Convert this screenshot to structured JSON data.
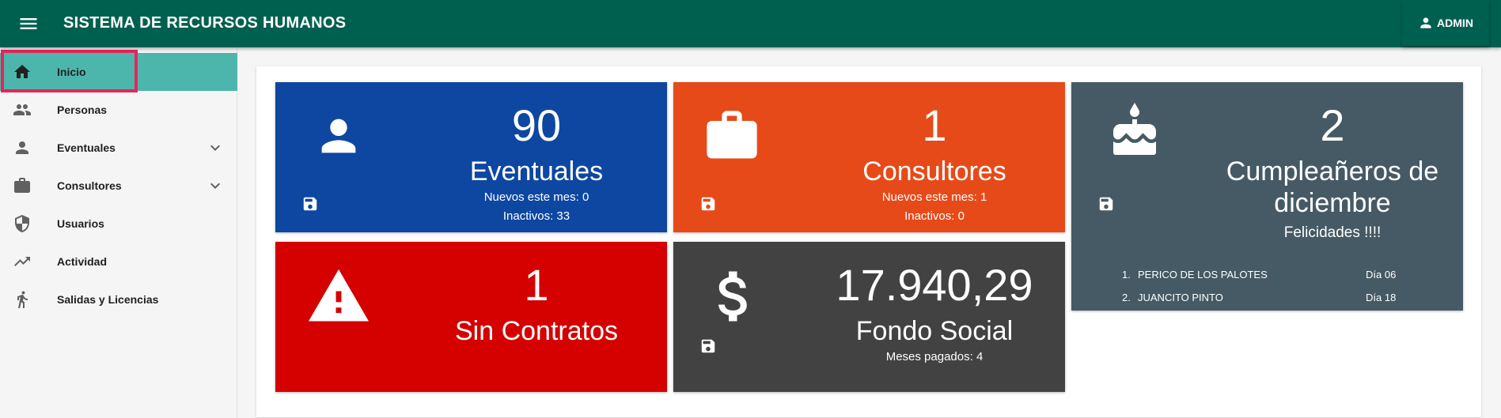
{
  "app": {
    "title": "SISTEMA DE RECURSOS HUMANOS",
    "user_button": "ADMIN"
  },
  "sidebar": {
    "items": [
      {
        "label": "Inicio",
        "icon": "home-icon",
        "active": true
      },
      {
        "label": "Personas",
        "icon": "people-icon"
      },
      {
        "label": "Eventuales",
        "icon": "person-icon",
        "expandable": true
      },
      {
        "label": "Consultores",
        "icon": "briefcase-icon",
        "expandable": true
      },
      {
        "label": "Usuarios",
        "icon": "shield-icon"
      },
      {
        "label": "Actividad",
        "icon": "trending-icon"
      },
      {
        "label": "Salidas y Licencias",
        "icon": "walking-icon"
      }
    ]
  },
  "tiles": {
    "eventuales": {
      "count": "90",
      "label": "Eventuales",
      "line1": "Nuevos este mes: 0",
      "line2": "Inactivos: 33",
      "color": "#0d47a1"
    },
    "consultores": {
      "count": "1",
      "label": "Consultores",
      "line1": "Nuevos este mes: 1",
      "line2": "Inactivos: 0",
      "color": "#e64a19"
    },
    "cumpleaneros": {
      "count": "2",
      "label_line1": "Cumpleañeros de",
      "label_line2": "diciembre",
      "greeting": "Felicidades !!!!",
      "list": [
        {
          "num": "1.",
          "name": "PERICO DE LOS PALOTES",
          "day": "Día 06"
        },
        {
          "num": "2.",
          "name": "JUANCITO PINTO",
          "day": "Día 18"
        }
      ],
      "color": "#455a64"
    },
    "sin_contratos": {
      "count": "1",
      "label": "Sin Contratos",
      "color": "#d50000"
    },
    "fondo_social": {
      "amount": "17.940,29",
      "label": "Fondo Social",
      "line1": "Meses pagados: 4",
      "color": "#424242"
    }
  },
  "colors": {
    "appbar": "#00604f",
    "active_nav": "#4db6ac",
    "highlight": "#e8245a"
  }
}
